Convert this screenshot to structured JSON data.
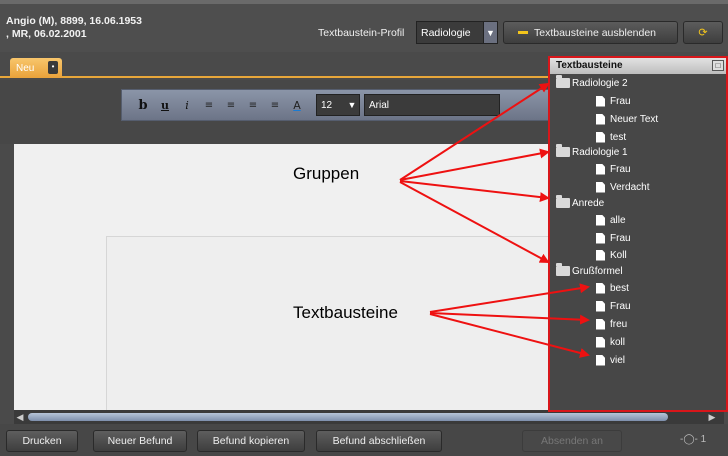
{
  "patient": {
    "line1": "Angio (M), 8899, 16.06.1953",
    "line2": ", MR, 06.02.2001"
  },
  "profile": {
    "label": "Textbaustein-Profil",
    "value": "Radiologie"
  },
  "hide_button_label": "Textbausteine ausblenden",
  "tab_label": "Neu",
  "toolbar": {
    "bold": "b",
    "underline": "u",
    "italic": "i",
    "color_letter": "A",
    "font_size": "12",
    "font_name": "Arial"
  },
  "panel": {
    "title": "Textbausteine",
    "groups": [
      {
        "name": "Radiologie 2",
        "items": [
          "Frau",
          "Neuer Text",
          "test"
        ]
      },
      {
        "name": "Radiologie 1",
        "items": [
          "Frau",
          "Verdacht"
        ]
      },
      {
        "name": "Anrede",
        "items": [
          "alle",
          "Frau",
          "Koll"
        ]
      },
      {
        "name": "Grußformel",
        "items": [
          "best",
          "Frau",
          "freu",
          "koll",
          "viel"
        ]
      }
    ]
  },
  "annotations": {
    "groups": "Gruppen",
    "snippets": "Textbausteine"
  },
  "bottom_buttons": {
    "print": "Drucken",
    "new_report": "Neuer Befund",
    "copy_report": "Befund kopieren",
    "finish_report": "Befund abschließen",
    "send_to": "Absenden an"
  },
  "zoom_label": "1",
  "colors": {
    "tab_orange": "#e9a23a",
    "highlight_red": "#d8161a",
    "toolbar_blue": "#7d869a"
  }
}
